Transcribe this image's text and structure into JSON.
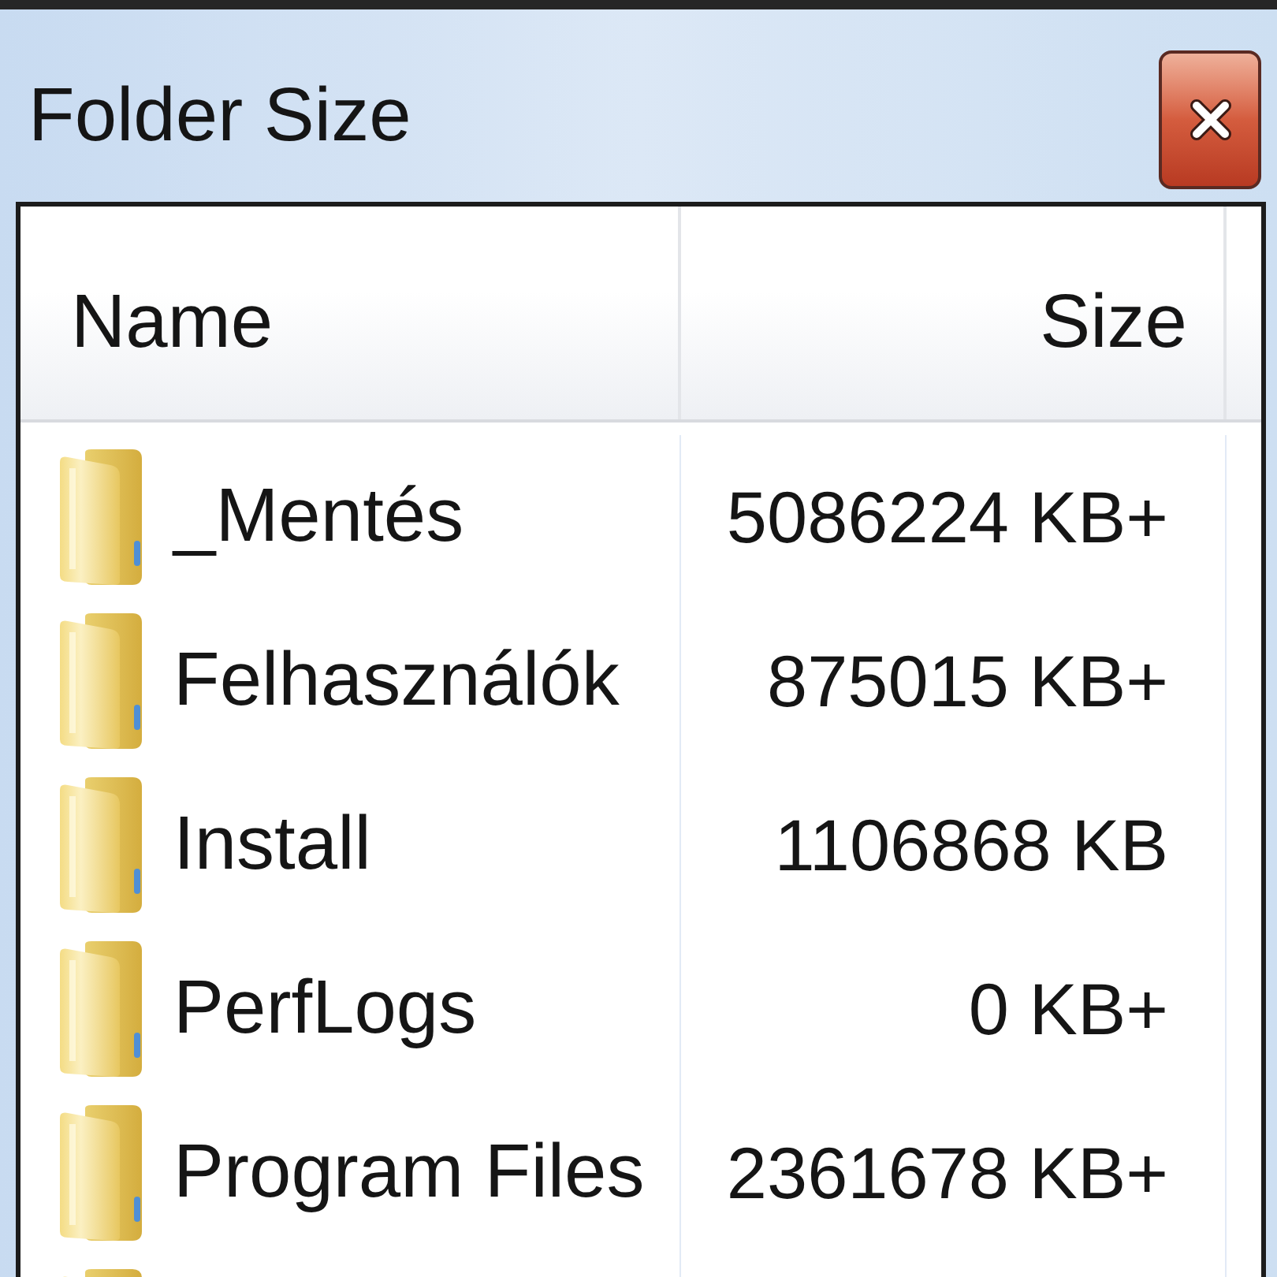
{
  "window": {
    "title": "Folder Size"
  },
  "table": {
    "columns": [
      "Name",
      "Size"
    ],
    "rows": [
      {
        "kind": "folder",
        "name": "_Mentés",
        "size": "5086224 KB+"
      },
      {
        "kind": "folder",
        "name": "Felhasználók",
        "size": "875015 KB+"
      },
      {
        "kind": "folder",
        "name": "Install",
        "size": "1106868 KB"
      },
      {
        "kind": "folder",
        "name": "PerfLogs",
        "size": "0 KB+"
      },
      {
        "kind": "folder",
        "name": "Program Files",
        "size": "2361678 KB+"
      },
      {
        "kind": "folder"
      }
    ]
  }
}
